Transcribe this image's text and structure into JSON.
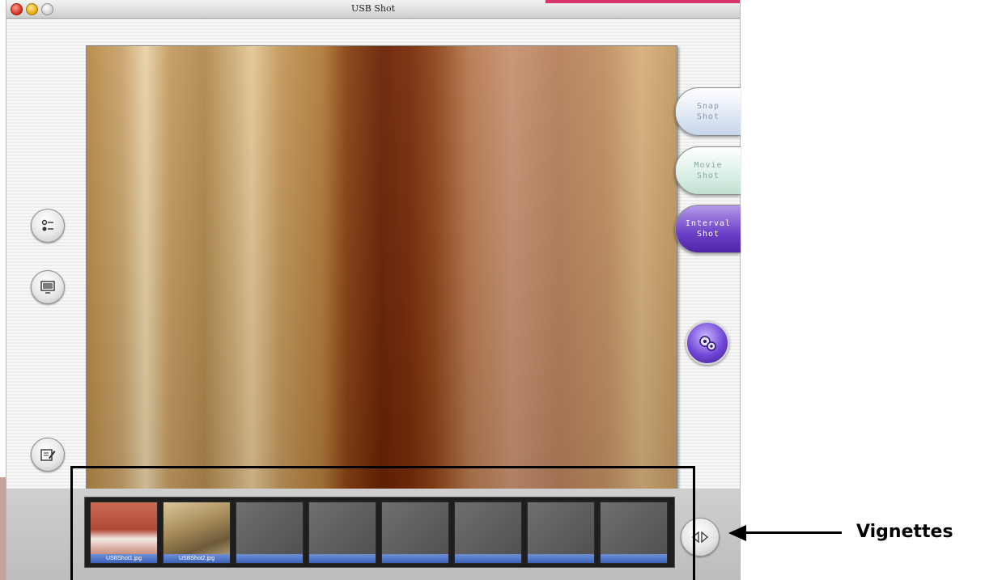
{
  "window": {
    "title": "USB Shot"
  },
  "right_panel": {
    "snap": {
      "line1": "Snap",
      "line2": "Shot"
    },
    "movie": {
      "line1": "Movie",
      "line2": "Shot"
    },
    "interval": {
      "line1": "Interval",
      "line2": "Shot"
    },
    "settings_icon": "gear-icon"
  },
  "left_panel": {
    "buttons": [
      {
        "name": "options-button",
        "icon": "toggle-options-icon"
      },
      {
        "name": "display-button",
        "icon": "monitor-icon"
      },
      {
        "name": "edit-button",
        "icon": "pencil-note-icon"
      },
      {
        "name": "capture-button",
        "icon": "camera-frame-icon"
      }
    ]
  },
  "filmstrip": {
    "thumbnails": [
      {
        "label": "USBShot1.jpg",
        "filled": true
      },
      {
        "label": "USBShot2.jpg",
        "filled": true
      },
      {
        "label": "",
        "filled": false
      },
      {
        "label": "",
        "filled": false
      },
      {
        "label": "",
        "filled": false
      },
      {
        "label": "",
        "filled": false
      },
      {
        "label": "",
        "filled": false
      },
      {
        "label": "",
        "filled": false
      }
    ]
  },
  "annotation": {
    "label": "Vignettes"
  },
  "colors": {
    "accent_purple": "#6b3fc7",
    "thumb_bar_blue": "#3d63b8",
    "titlebar_close": "#d52b1e"
  }
}
